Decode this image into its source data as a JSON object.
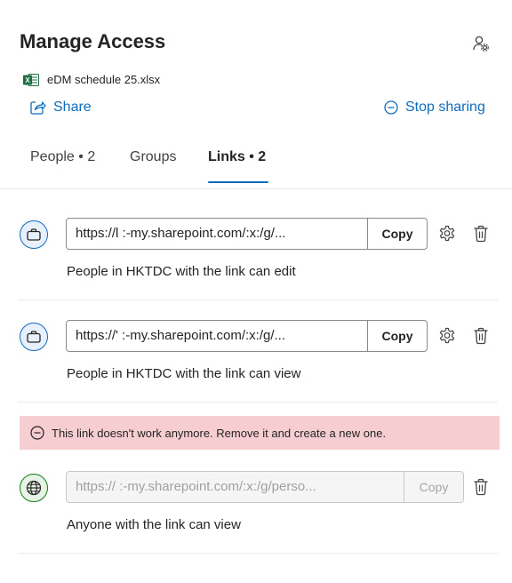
{
  "header": {
    "title": "Manage Access",
    "settings_icon": "person-settings-icon"
  },
  "file": {
    "name": "eDM schedule 25.xlsx",
    "icon": "excel-icon"
  },
  "actions": {
    "share_label": "Share",
    "stop_sharing_label": "Stop sharing"
  },
  "tabs": [
    {
      "label": "People • 2",
      "active": false
    },
    {
      "label": "Groups",
      "active": false
    },
    {
      "label": "Links • 2",
      "active": true
    }
  ],
  "links": [
    {
      "url": "https://l          :-my.sharepoint.com/:x:/g/...",
      "copy_label": "Copy",
      "description": "People in HKTDC with the link can edit",
      "icon": "briefcase-icon",
      "disabled": false
    },
    {
      "url": "https://'          :-my.sharepoint.com/:x:/g/...",
      "copy_label": "Copy",
      "description": "People in HKTDC with the link can view",
      "icon": "briefcase-icon",
      "disabled": false
    },
    {
      "url": "https://          :-my.sharepoint.com/:x:/g/perso...",
      "copy_label": "Copy",
      "description": "Anyone with the link can view",
      "icon": "globe-icon",
      "disabled": true,
      "error": "This link doesn't work anymore. Remove it and create a new one."
    }
  ],
  "colors": {
    "accent": "#0f6cbd",
    "error_bg": "#f6cdd1",
    "globe": "#107c10"
  }
}
